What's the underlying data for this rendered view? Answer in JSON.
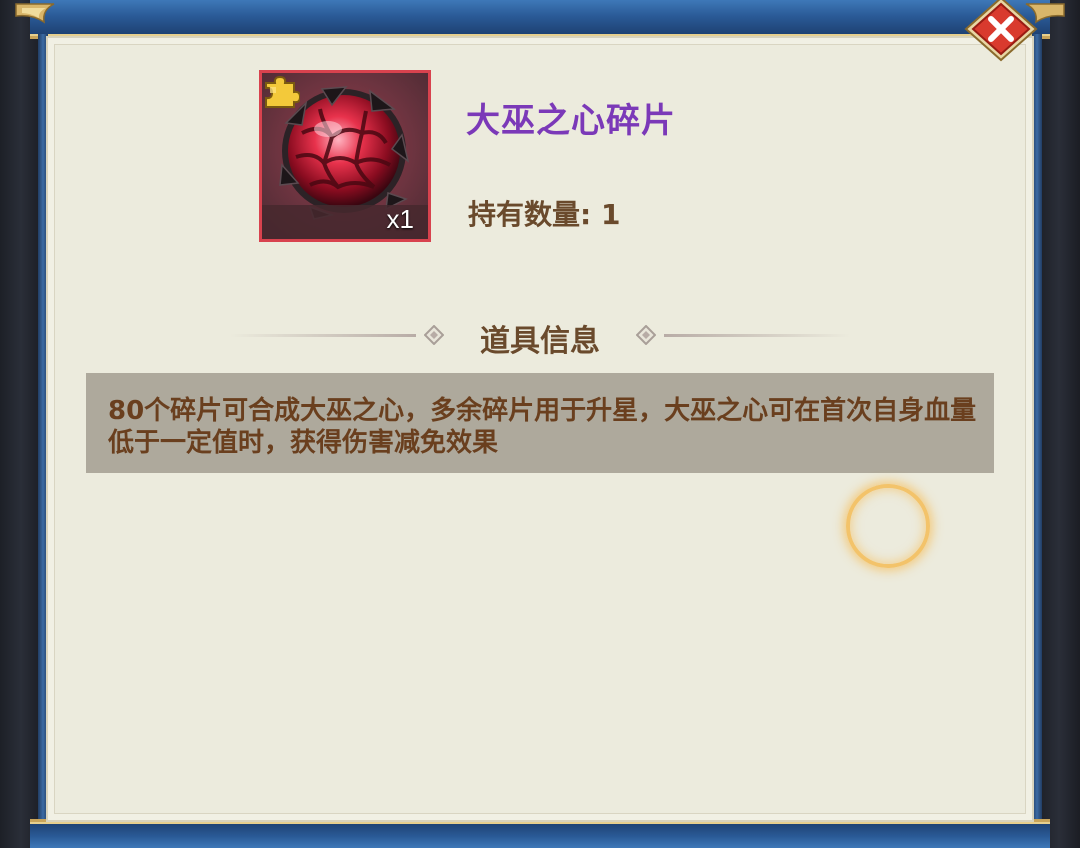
{
  "item": {
    "name": "大巫之心碎片",
    "quantity_badge": "x1",
    "owned_label": "持有数量: 1",
    "icon": "crimson-orb-fragment-icon",
    "badge_icon": "puzzle-piece-icon",
    "name_color": "#7b39b8",
    "border_color": "#d8424e"
  },
  "section": {
    "title": "道具信息"
  },
  "description": {
    "text": "80个碎片可合成大巫之心，多余碎片用于升星，大巫之心可在首次自身血量低于一定值时，获得伤害减免效果"
  },
  "controls": {
    "close_icon": "close-icon"
  },
  "colors": {
    "panel": "#ecebdd",
    "frame_blue": "#2a5a96",
    "frame_gold": "#c8a45a",
    "text_brown": "#6a4a2c",
    "desc_bg": "#aea99c",
    "close_red": "#d93a2e"
  }
}
